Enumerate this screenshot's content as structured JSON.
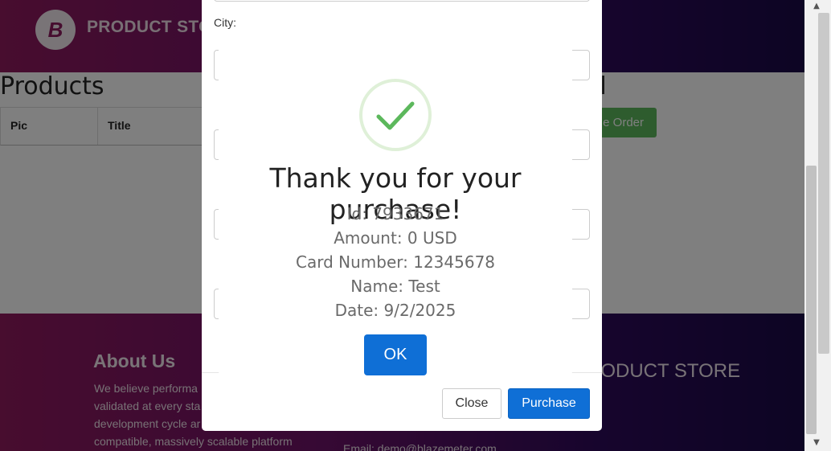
{
  "navbar": {
    "logo_letter": "B",
    "brand": "PRODUCT STORE"
  },
  "cart": {
    "title": "Products",
    "columns": [
      "Pic",
      "Title"
    ],
    "total_title": "al",
    "place_order_label": "e Order"
  },
  "footer": {
    "about_title": "About Us",
    "about_lines": [
      "We believe performa",
      "validated at every sta",
      "development cycle ar",
      "compatible, massively scalable platform"
    ],
    "brand": "RODUCT STORE",
    "email": "Email: demo@blazemeter.com"
  },
  "order_modal": {
    "city_label": "City:",
    "close_label": "Close",
    "purchase_label": "Purchase"
  },
  "alert": {
    "icon": "check-icon",
    "title": "Thank you for your purchase!",
    "lines": [
      "Id: 7933671",
      "Amount: 0 USD",
      "Card Number: 12345678",
      "Name: Test",
      "Date: 9/2/2025"
    ],
    "ok_label": "OK"
  },
  "scrollbar": {
    "up_icon": "arrow-up-icon",
    "down_icon": "arrow-down-icon"
  },
  "colors": {
    "navbar_start": "#901a5e",
    "navbar_end": "#1a0a48",
    "primary_button": "#0f6fd6",
    "success": "#5cb85c",
    "check": "#5cb85c"
  }
}
